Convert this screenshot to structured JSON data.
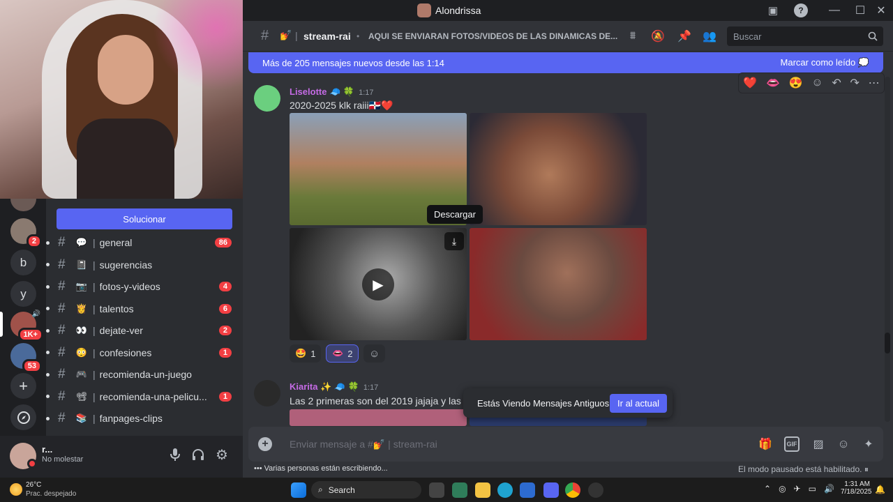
{
  "window": {
    "title": "Alondrissa"
  },
  "channel": {
    "name": "stream-rai",
    "emoji": "💅",
    "topic": "AQUI SE ENVIARAN FOTOS/VIDEOS DE LAS DINAMICAS DE...",
    "search_placeholder": "Buscar"
  },
  "new_messages_bar": {
    "text": "Más de 205 mensajes nuevos desde las 1:14",
    "mark_read": "Marcar como leído"
  },
  "solve_button": "Solucionar",
  "servers": [
    {
      "label": "",
      "badge": "2"
    },
    {
      "label": "b",
      "badge": ""
    },
    {
      "label": "y",
      "badge": ""
    },
    {
      "label": "",
      "badge": "1K+"
    },
    {
      "label": "",
      "badge": "53"
    }
  ],
  "channels": [
    {
      "emoji": "💬",
      "name": "general",
      "count": "86"
    },
    {
      "emoji": "📓",
      "name": "sugerencias",
      "count": ""
    },
    {
      "emoji": "📷",
      "name": "fotos-y-videos",
      "count": "4"
    },
    {
      "emoji": "👸",
      "name": "talentos",
      "count": "6"
    },
    {
      "emoji": "👀",
      "name": "dejate-ver",
      "count": "2"
    },
    {
      "emoji": "😳",
      "name": "confesiones",
      "count": "1"
    },
    {
      "emoji": "🎮",
      "name": "recomienda-un-juego",
      "count": ""
    },
    {
      "emoji": "📽",
      "name": "recomienda-una-pelicu...",
      "count": "1"
    },
    {
      "emoji": "📚",
      "name": "fanpages-clips",
      "count": ""
    }
  ],
  "user": {
    "name": "r...",
    "status": "No molestar"
  },
  "messages": [
    {
      "author": "Liselotte",
      "author_badges": "🧢 🍀",
      "time": "1:17",
      "text": "2020-2025 klk raiii🇩🇴❤️",
      "reactions": [
        {
          "emoji": "🤩",
          "count": "1",
          "active": false
        },
        {
          "emoji": "👄",
          "count": "2",
          "active": true
        }
      ]
    },
    {
      "author": "Kiarita",
      "author_badges": "✨ 🧢 🍀",
      "time": "1:17",
      "text": "Las 2 primeras son del 2019 jajaja y las o"
    }
  ],
  "hover_reactions": [
    "❤️",
    "👄",
    "😍"
  ],
  "tooltip_download": "Descargar",
  "old_messages": {
    "text": "Estás Viendo Mensajes Antiguos",
    "button": "Ir al actual"
  },
  "composer": {
    "placeholder": "Enviar mensaje a #💅 | stream-rai",
    "gif": "GIF"
  },
  "typing": "Varias personas están escribiendo...",
  "paused": "El modo pausado está habilitado.",
  "taskbar": {
    "weather_temp": "26°C",
    "weather_desc": "Prac. despejado",
    "search": "Search",
    "time": "1:31 AM",
    "date": "7/18/2025"
  }
}
